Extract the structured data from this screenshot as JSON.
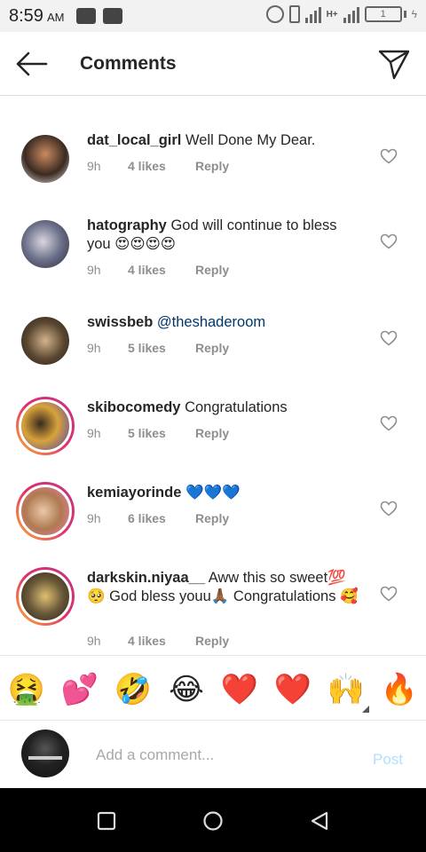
{
  "status_bar": {
    "time": "8:59",
    "ampm": "AM",
    "battery": "1"
  },
  "header": {
    "title": "Comments"
  },
  "comments": [
    {
      "username": "dat_local_girl",
      "text": "Well Done My  Dear.",
      "time": "9h",
      "likes": "4 likes",
      "reply": "Reply",
      "ring": false,
      "avatar_color": "#3a2a22"
    },
    {
      "username": "hatography",
      "text": "God will continue to bless you 😍😍😍😍",
      "time": "9h",
      "likes": "4 likes",
      "reply": "Reply",
      "ring": false,
      "avatar_color": "#6b6f8a"
    },
    {
      "username": "swissbeb",
      "mention": "@theshaderoom",
      "text": "",
      "time": "9h",
      "likes": "5 likes",
      "reply": "Reply",
      "ring": false,
      "avatar_color": "#5a4630"
    },
    {
      "username": "skibocomedy",
      "text": "Congratulations",
      "time": "9h",
      "likes": "5 likes",
      "reply": "Reply",
      "ring": true,
      "avatar_color": "#d8a33a"
    },
    {
      "username": "kemiayorinde",
      "text": "💙💙💙",
      "time": "9h",
      "likes": "6 likes",
      "reply": "Reply",
      "ring": true,
      "avatar_color": "#b07a52"
    },
    {
      "username": "darkskin.niyaa__",
      "text": "Aww this so sweet💯🥺 God bless youu🙏🏾 Congratulations 🥰",
      "time": "9h",
      "likes": "4 likes",
      "reply": "Reply",
      "ring": true,
      "avatar_color": "#6b5a3a"
    }
  ],
  "emoji_bar": [
    "🤮",
    "💕",
    "🤣",
    "😂",
    "❤️",
    "❤️",
    "🙌",
    "🔥"
  ],
  "add_comment": {
    "placeholder": "Add a comment...",
    "post_label": "Post"
  },
  "colors": {
    "post_disabled": "#b2dffc",
    "meta_gray": "#8e8e8e",
    "story_ring_start": "#f9b233",
    "story_ring_end": "#c13584"
  },
  "icons": {
    "back": "arrow-left-icon",
    "share": "paper-plane-icon",
    "like": "heart-outline-icon",
    "nav_recents": "square-icon",
    "nav_home": "circle-icon",
    "nav_back": "triangle-back-icon"
  }
}
